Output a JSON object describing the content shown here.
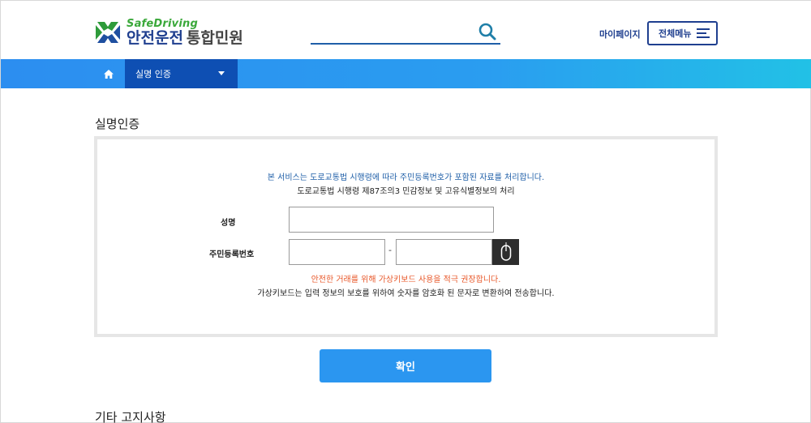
{
  "header": {
    "logo_en": "SafeDriving",
    "logo_ko": "안전운전",
    "logo_sub": "통합민원",
    "search_placeholder": "",
    "mypage_label": "마이페이지",
    "allmenu_label": "전체메뉴"
  },
  "nav": {
    "crumb_label": "실명 인증"
  },
  "main": {
    "page_title": "실명인증",
    "notice_line1": "본 서비스는 도로교통법 시행령에 따라 주민등록번호가 포함된 자료를 처리합니다.",
    "notice_line2": "도로교통법 시행령 제87조의3 민감정보 및 고유식별정보의 처리",
    "name_label": "성명",
    "name_value": "",
    "rrn_label": "주민등록번호",
    "rrn_front_value": "",
    "rrn_back_value": "",
    "dash": "-",
    "warning_text": "안전한 거래를 위해 가상키보드 사용을 적극 권장합니다.",
    "description_text": "가상키보드는 입력 정보의 보호를 위하여 숫자를 암호화 된 문자로 변환하여 전송합니다.",
    "confirm_label": "확인",
    "section2_title": "기타 고지사항"
  },
  "colors": {
    "brand_blue": "#1f3f8f",
    "nav_gradient_start": "#2c8ef0",
    "nav_gradient_end": "#22c1e6",
    "crumb_bg": "#0e4fb3",
    "warning": "#e8582a",
    "button": "#2b96f0"
  },
  "icons": {
    "logo": "safedriving-logo-icon",
    "search": "search-icon",
    "menu": "hamburger-icon",
    "home": "home-icon",
    "caret": "caret-down-icon",
    "keyboard": "mouse-icon"
  }
}
